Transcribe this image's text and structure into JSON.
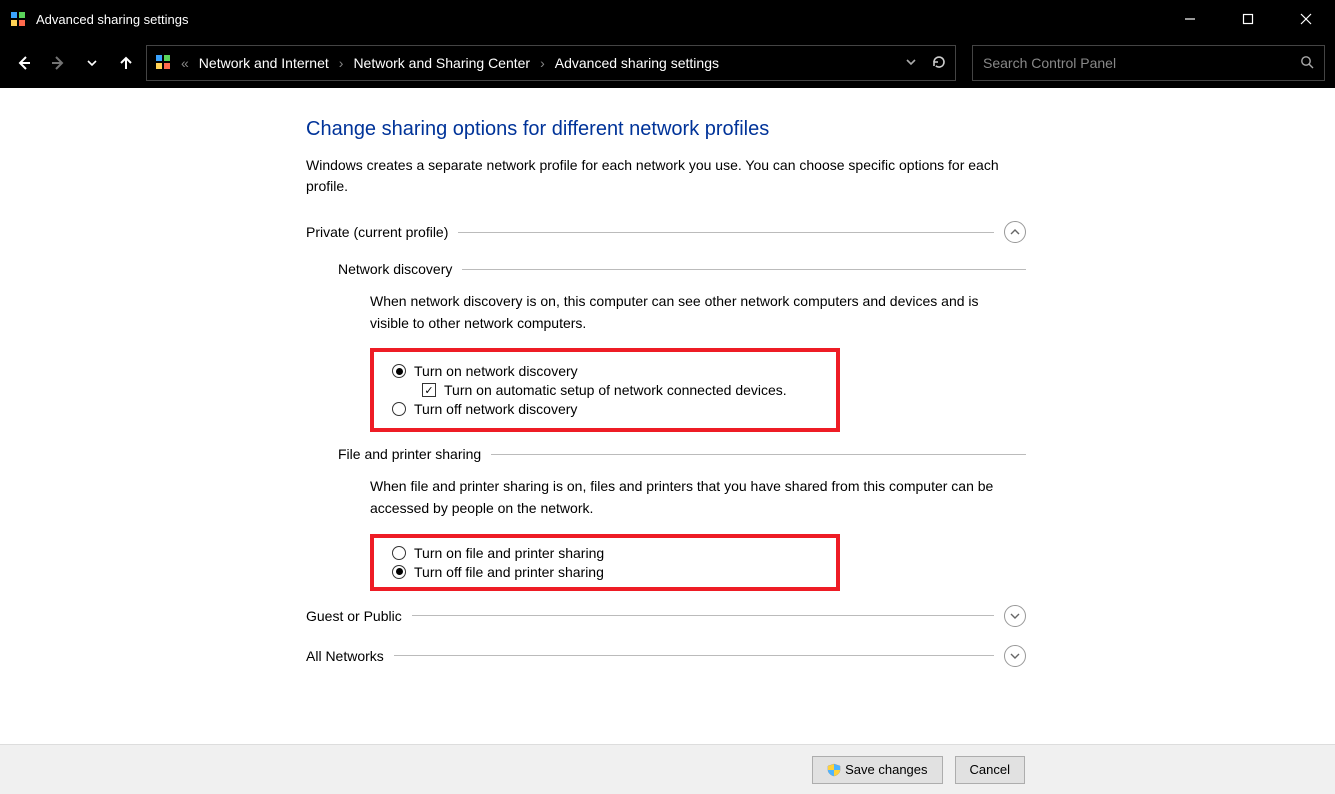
{
  "titlebar": {
    "title": "Advanced sharing settings"
  },
  "breadcrumb": {
    "item1": "Network and Internet",
    "item2": "Network and Sharing Center",
    "item3": "Advanced sharing settings"
  },
  "search": {
    "placeholder": "Search Control Panel"
  },
  "page": {
    "heading": "Change sharing options for different network profiles",
    "description": "Windows creates a separate network profile for each network you use. You can choose specific options for each profile."
  },
  "sections": {
    "private": {
      "label": "Private (current profile)",
      "network_discovery": {
        "title": "Network discovery",
        "desc": "When network discovery is on, this computer can see other network computers and devices and is visible to other network computers.",
        "opt_on": "Turn on network discovery",
        "opt_auto": "Turn on automatic setup of network connected devices.",
        "opt_off": "Turn off network discovery"
      },
      "file_printer": {
        "title": "File and printer sharing",
        "desc": "When file and printer sharing is on, files and printers that you have shared from this computer can be accessed by people on the network.",
        "opt_on": "Turn on file and printer sharing",
        "opt_off": "Turn off file and printer sharing"
      }
    },
    "guest": {
      "label": "Guest or Public"
    },
    "all": {
      "label": "All Networks"
    }
  },
  "buttons": {
    "save": "Save changes",
    "cancel": "Cancel"
  }
}
